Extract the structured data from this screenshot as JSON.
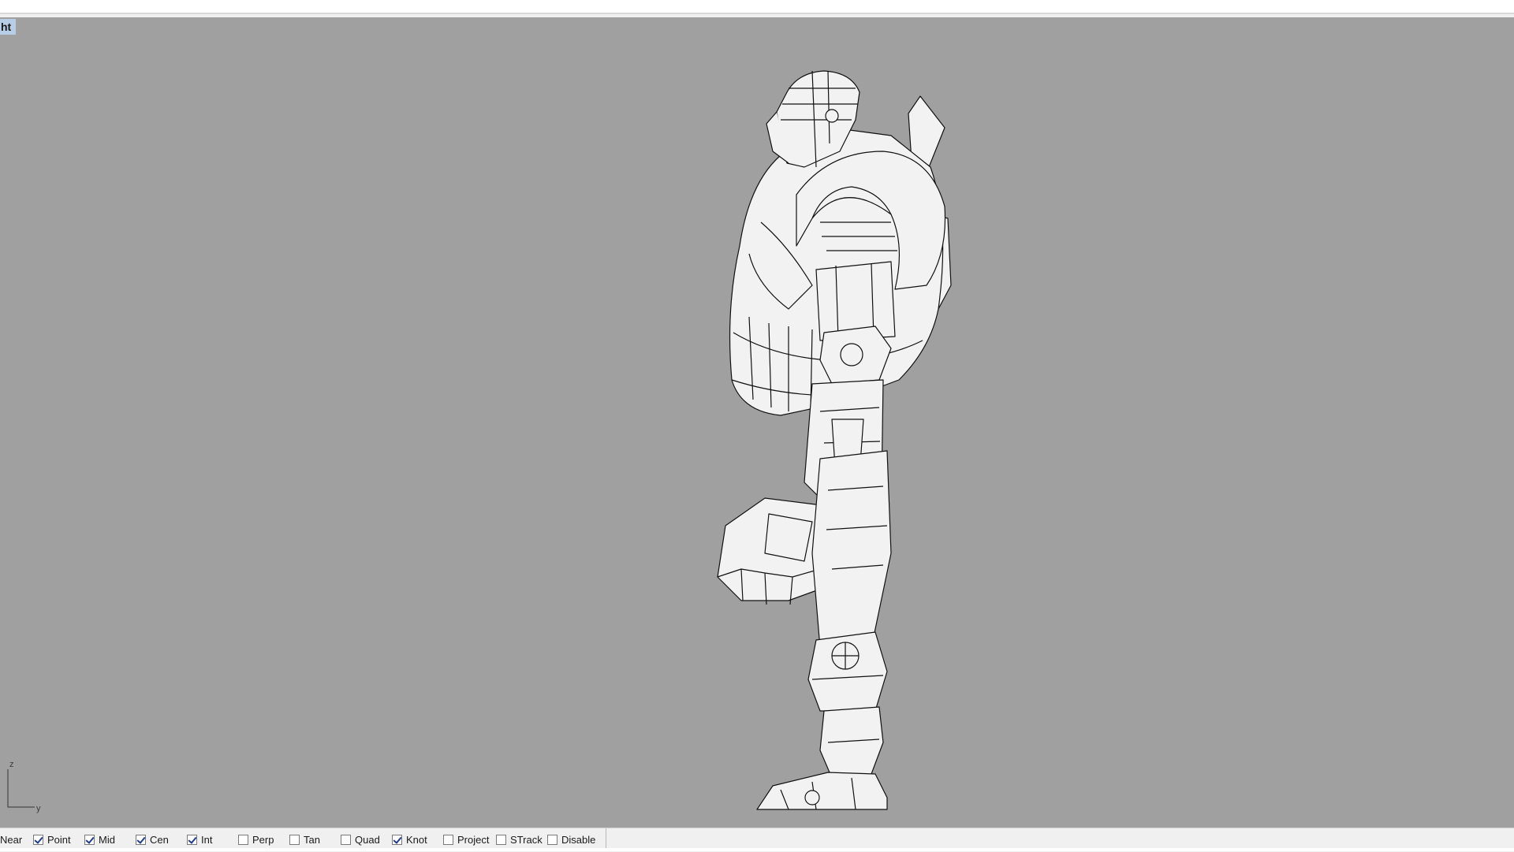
{
  "viewport": {
    "title": "ht",
    "background": "#a0a0a0",
    "axis": {
      "z_label": "z",
      "y_label": "y"
    }
  },
  "osnap": {
    "items": [
      {
        "label": "Near",
        "checked": null
      },
      {
        "label": "Point",
        "checked": true
      },
      {
        "label": "Mid",
        "checked": true
      },
      {
        "label": "Cen",
        "checked": true
      },
      {
        "label": "Int",
        "checked": true
      },
      {
        "label": "Perp",
        "checked": false
      },
      {
        "label": "Tan",
        "checked": false
      },
      {
        "label": "Quad",
        "checked": false
      },
      {
        "label": "Knot",
        "checked": true
      },
      {
        "label": "Project",
        "checked": false
      },
      {
        "label": "STrack",
        "checked": false
      },
      {
        "label": "Disable",
        "checked": false
      }
    ]
  }
}
